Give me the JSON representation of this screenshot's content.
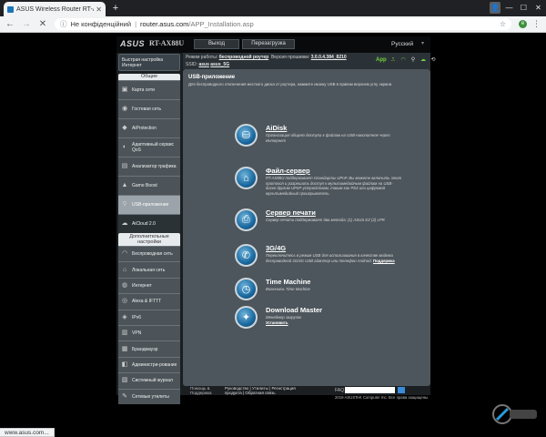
{
  "browser": {
    "tab_title": "ASUS Wireless Router RT-AX88U",
    "address_insecure": "Не конфіденційний",
    "address_host": "router.asus.com",
    "address_path": "/APP_Installation.asp",
    "status_text": "www.asus.com..."
  },
  "router": {
    "logo": "ASUS",
    "model": "RT-AX88U",
    "logout_label": "Выход",
    "reboot_label": "Перезагрузка",
    "language": "Русский",
    "info": {
      "mode_label": "Режим работы:",
      "mode_value": "беспроводной роутер",
      "firmware_label": "Версия прошивки:",
      "firmware_value": "3.0.0.4.384_8210",
      "ssid_label": "SSID:",
      "ssid_1": "asus",
      "ssid_2": "asus_5G",
      "app_label": "App"
    },
    "sidebar": {
      "quick_setup": "Быстрая настройка Интернет",
      "general_header": "Общие",
      "general_items": [
        {
          "label": "Карта сети",
          "icon": "network-map-icon",
          "glyph": "▣"
        },
        {
          "label": "Гостевая сеть",
          "icon": "guest-network-icon",
          "glyph": "◉"
        },
        {
          "label": "AiProtection",
          "icon": "shield-icon",
          "glyph": "◆"
        },
        {
          "label": "Адаптивный сервис QoS",
          "icon": "qos-icon",
          "glyph": "◐"
        },
        {
          "label": "Анализатор трафика",
          "icon": "traffic-analyzer-icon",
          "glyph": "▤"
        },
        {
          "label": "Game Boost",
          "icon": "game-icon",
          "glyph": "▲"
        },
        {
          "label": "USB-приложение",
          "icon": "usb-icon",
          "glyph": "⚲"
        },
        {
          "label": "AiCloud 2.0",
          "icon": "cloud-icon",
          "glyph": "☁"
        }
      ],
      "advanced_header": "Дополнительные настройки",
      "advanced_items": [
        {
          "label": "Беспроводная сеть",
          "icon": "wireless-icon",
          "glyph": "◠"
        },
        {
          "label": "Локальная сеть",
          "icon": "lan-icon",
          "glyph": "⌂"
        },
        {
          "label": "Интернет",
          "icon": "globe-icon",
          "glyph": "◍"
        },
        {
          "label": "Alexa & IFTTT",
          "icon": "alexa-icon",
          "glyph": "◎"
        },
        {
          "label": "IPv6",
          "icon": "ipv6-icon",
          "glyph": "◈"
        },
        {
          "label": "VPN",
          "icon": "vpn-icon",
          "glyph": "▥"
        },
        {
          "label": "Брандмауэр",
          "icon": "firewall-icon",
          "glyph": "▦"
        },
        {
          "label": "Администри-рование",
          "icon": "admin-icon",
          "glyph": "◧"
        },
        {
          "label": "Системный журнал",
          "icon": "log-icon",
          "glyph": "▧"
        },
        {
          "label": "Сетевые утилиты",
          "icon": "tools-icon",
          "glyph": "✎"
        }
      ]
    },
    "content": {
      "title": "USB-приложение",
      "description": "Для беспроводного отключения жесткого диска от роутера, нажмите иконку USB в правом верхнем углу экрана",
      "features": [
        {
          "name": "AiDisk",
          "icon": "aidisk-icon",
          "glyph": "⛁",
          "text": "Организация общего доступа к файлам на USB-накопителе через Интернет",
          "link": ""
        },
        {
          "name": "Файл-сервер",
          "icon": "media-server-icon",
          "glyph": "⌂",
          "text": "RT-AX88U поддерживает стандарты UPnP. Вы можете включить этот протокол и разрешить доступ к мультимедийным файлам на USB-диске другим UPnP-устройствам, таким как PS3 или цифровой мультимедийный проигрыватель.",
          "link": ""
        },
        {
          "name": "Сервер печати",
          "icon": "printer-icon",
          "glyph": "⎙",
          "text": "Сервер печати поддерживает два метода: (1) ASUS EZ (2) LPR",
          "link": ""
        },
        {
          "name": "3G/4G",
          "icon": "mobile-modem-icon",
          "glyph": "✆",
          "text": "Переключитесь в режим USB для использования в качестве модема беспроводной 3G/4G USB адаптер или телефон Android.",
          "link": "Поддержка"
        },
        {
          "name": "Time Machine",
          "icon": "time-machine-icon",
          "glyph": "◷",
          "text": "Включить Time Machine",
          "link": ""
        },
        {
          "name": "Download Master",
          "icon": "download-master-icon",
          "glyph": "✦",
          "text": "Менеджер загрузок",
          "link": "Установить"
        }
      ]
    },
    "footer": {
      "help": "Помощь & Поддержка",
      "links_row1": "Руководство | Утилиты | Регистрация",
      "links_row2": "продукта | Обратная связь",
      "faq": "FAQ",
      "copyright": "2019 ASUSTeK Computer Inc. Все права защищены."
    }
  }
}
